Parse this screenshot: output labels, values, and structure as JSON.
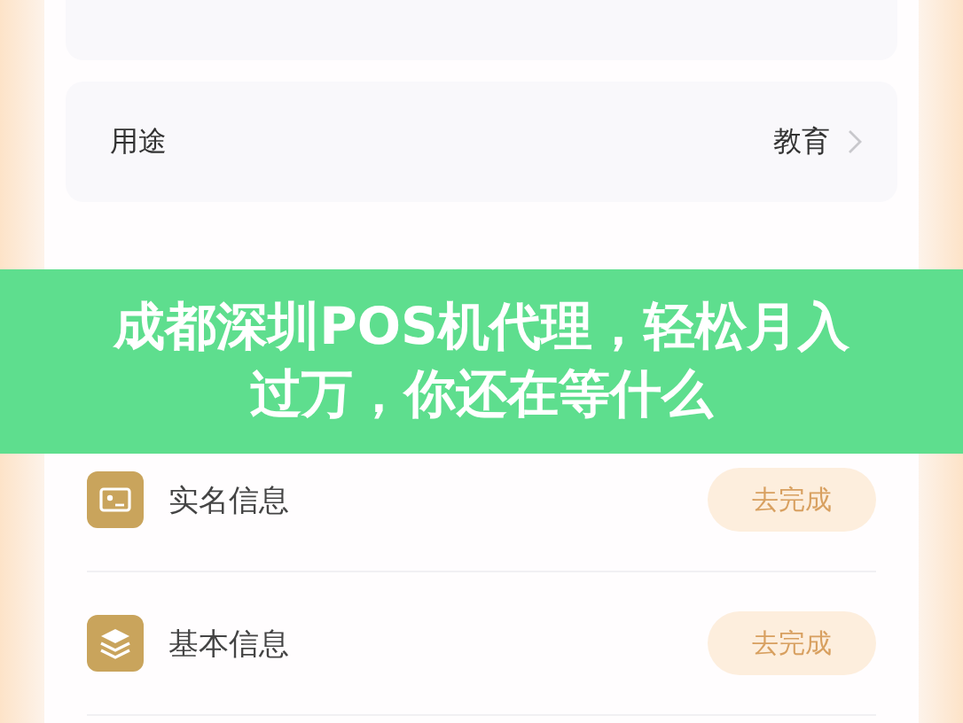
{
  "settings": [
    {
      "label": "用途",
      "value": "教育"
    }
  ],
  "tasks": [
    {
      "kind": "id-card",
      "label": "实名信息",
      "action": "去完成"
    },
    {
      "kind": "layers",
      "label": "基本信息",
      "action": "去完成"
    }
  ],
  "banner": {
    "title": "成都深圳POS机代理，轻松月入过万，你还在等什么"
  }
}
